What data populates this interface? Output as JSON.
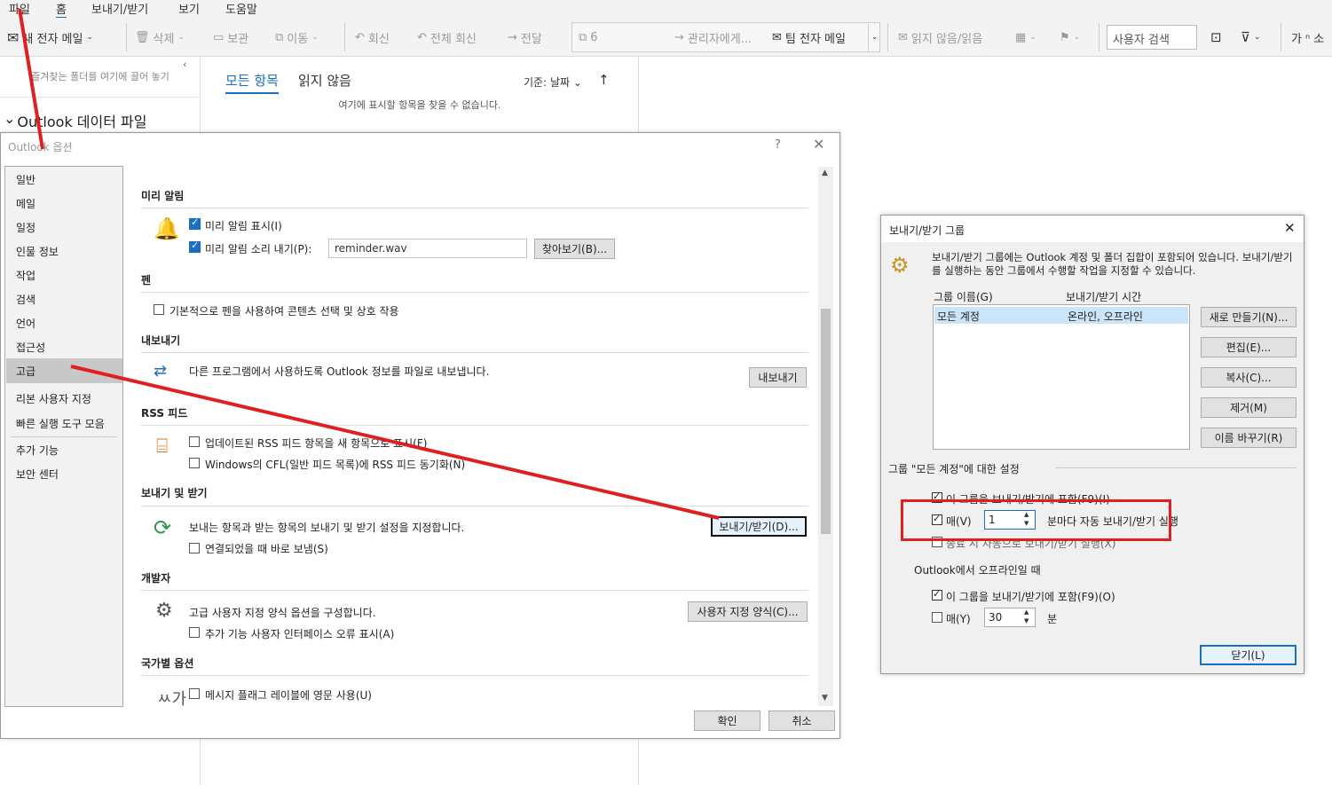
{
  "menubar": {
    "items": [
      "파일",
      "홈",
      "보내기/받기",
      "보기",
      "도움말"
    ]
  },
  "ribbon": {
    "new_mail": "새 전자 메일",
    "delete": "삭제",
    "archive": "보관",
    "move": "이동",
    "reply": "회신",
    "reply_all": "전체 회신",
    "forward": "전달",
    "quickstep_count": "6",
    "to_manager": "관리자에게...",
    "team_mail": "팀 전자 메일",
    "unread_read": "읽지 않음/읽음",
    "search_people": "사용자 검색",
    "font_size": "가"
  },
  "folder_pane": {
    "favorites_hint": "즐겨찾는 폴더를 여기에 끌어 놓기",
    "data_file": "Outlook 데이터 파일"
  },
  "list_pane": {
    "tab_all": "모든 항목",
    "tab_unread": "읽지 않음",
    "sort_by": "기준: 날짜",
    "empty": "여기에 표시할 항목을 찾을 수 없습니다."
  },
  "options_dialog": {
    "title": "Outlook 옵션",
    "help": "?",
    "nav": [
      "일반",
      "메일",
      "일정",
      "인물 정보",
      "작업",
      "검색",
      "언어",
      "접근성",
      "고급",
      "리본 사용자 지정",
      "빠른 실행 도구 모음",
      "추가 기능",
      "보안 센터"
    ],
    "selected_nav": "고급",
    "sections": {
      "reminders": "미리 알림",
      "show_reminders": "미리 알림 표시(I)",
      "play_sound": "미리 알림 소리 내기(P):",
      "sound_file": "reminder.wav",
      "browse": "찾아보기(B)...",
      "pen": "펜",
      "pen_option": "기본적으로 펜을 사용하여 콘텐츠 선택 및 상호 작용",
      "export": "내보내기",
      "export_desc": "다른 프로그램에서 사용하도록 Outlook 정보를 파일로 내보냅니다.",
      "export_btn": "내보내기",
      "rss": "RSS 피드",
      "rss_opt1": "업데이트된 RSS 피드 항목을 새 항목으로 표시(F)",
      "rss_opt2": "Windows의 CFL(일반 피드 목록)에 RSS 피드 동기화(N)",
      "send_receive": "보내기 및 받기",
      "sr_desc": "보내는 항목과 받는 항목의 보내기 및 받기 설정을 지정합니다.",
      "sr_btn": "보내기/받기(D)...",
      "send_immediately": "연결되었을 때 바로 보냄(S)",
      "developer": "개발자",
      "dev_desc": "고급 사용자 지정 양식 옵션을 구성합니다.",
      "dev_btn": "사용자 지정 양식(C)...",
      "addin_errors": "추가 기능 사용자 인터페이스 오류 표시(A)",
      "intl": "국가별 옵션",
      "intl_opt": "메시지 플래그 레이블에 영문 사용(U)"
    },
    "ok": "확인",
    "cancel": "취소"
  },
  "sr_dialog": {
    "title": "보내기/받기 그룹",
    "desc": "보내기/받기 그룹에는 Outlook 계정 및 폴더 집합이 포함되어 있습니다. 보내기/받기를 실행하는 동안 그룹에서 수행할 작업을 지정할 수 있습니다.",
    "col_name": "그룹 이름(G)",
    "col_time": "보내기/받기 시간",
    "rows": [
      {
        "name": "모든 계정",
        "time": "온라인, 오프라인"
      }
    ],
    "btn_new": "새로 만들기(N)...",
    "btn_edit": "편집(E)...",
    "btn_copy": "복사(C)...",
    "btn_remove": "제거(M)",
    "btn_rename": "이름 바꾸기(R)",
    "settings_for": "그룹 \"모든 계정\"에 대한 설정",
    "online_include": "이 그룹을 보내기/받기에 포함(F9)(I)",
    "every": "매(V)",
    "every_value": "1",
    "minutes_auto": "분마다 자동 보내기/받기 실행",
    "on_exit": "종료 시 자동으로 보내기/받기 실행(X)",
    "offline_header": "Outlook에서 오프라인일 때",
    "offline_include": "이 그룹을 보내기/받기에 포함(F9)(O)",
    "offline_every": "매(Y)",
    "offline_value": "30",
    "minutes": "분",
    "close": "닫기(L)"
  },
  "colors": {
    "accent": "#1a6fc4",
    "highlight_red": "#e02020",
    "selection": "#cce4f7"
  }
}
